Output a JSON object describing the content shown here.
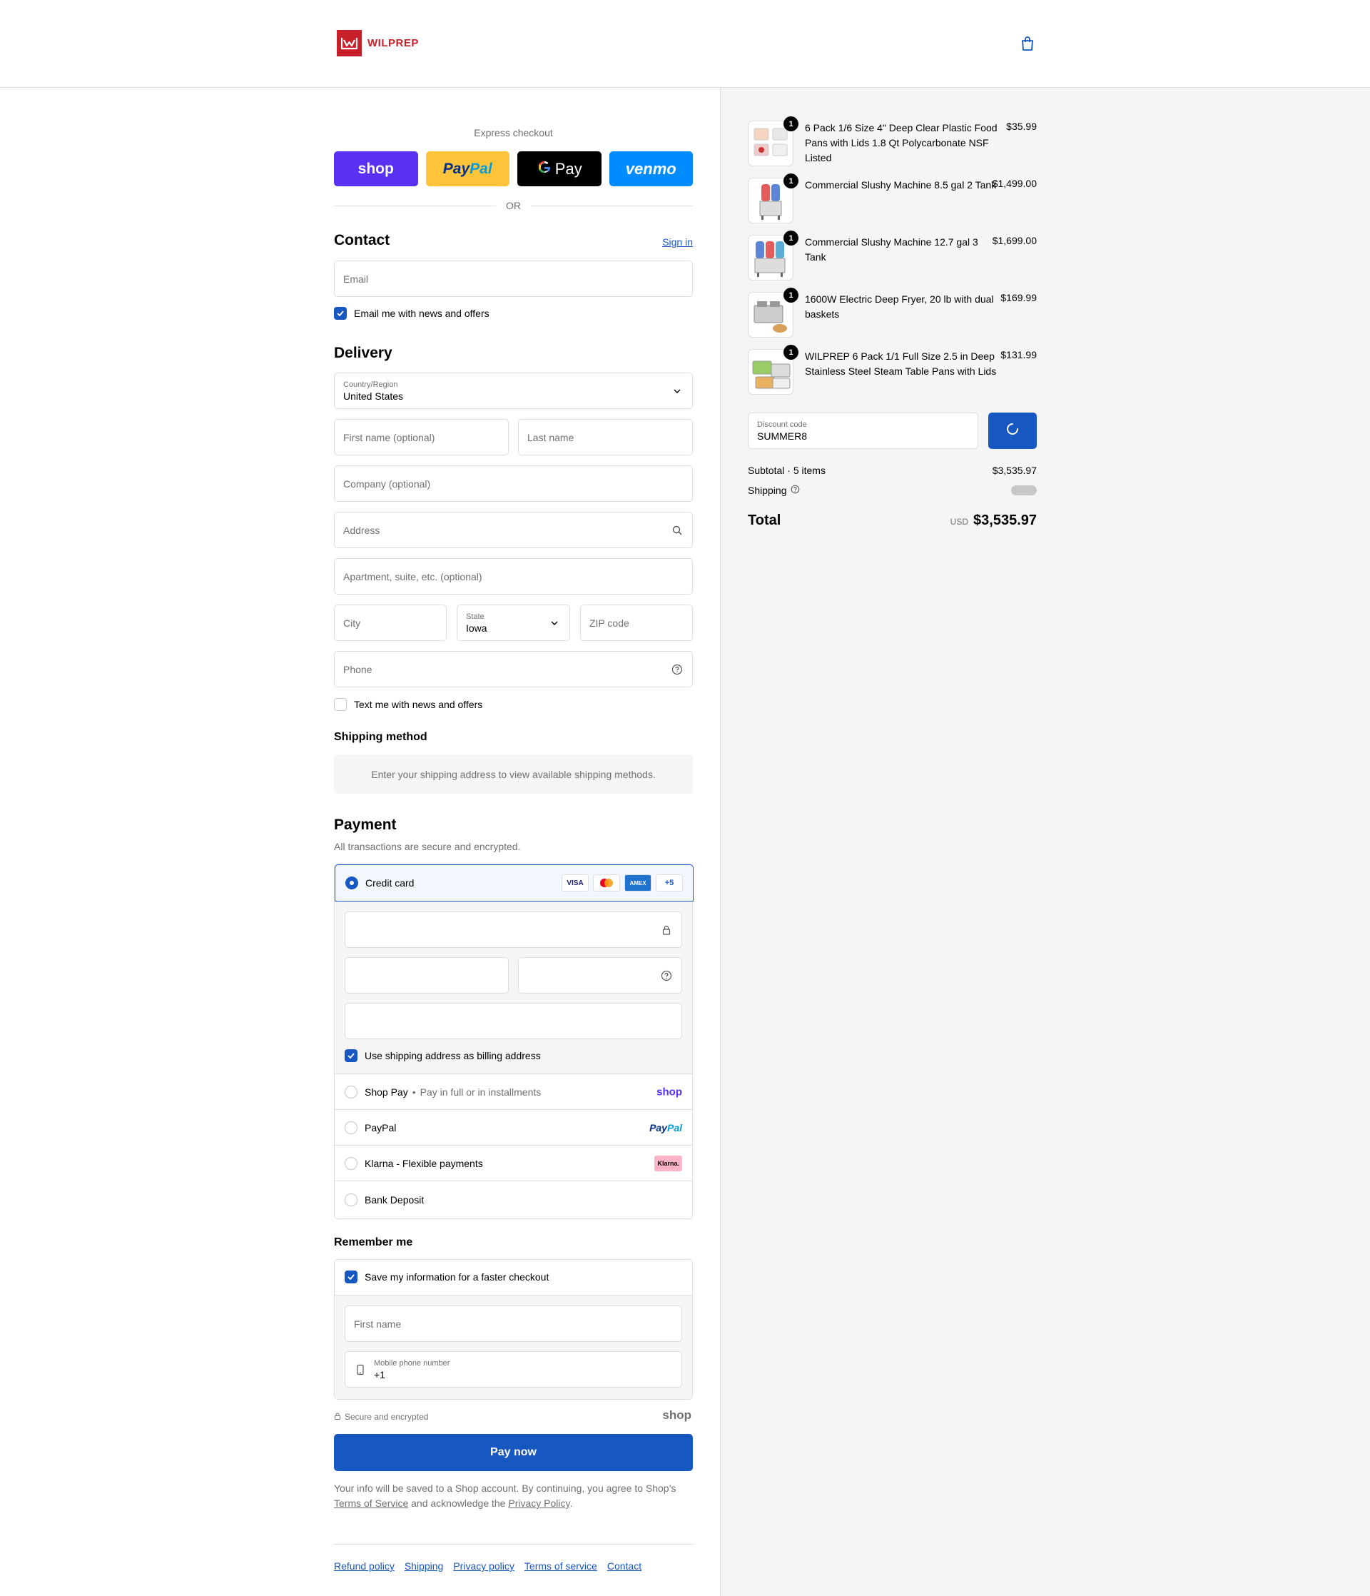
{
  "brand": {
    "name": "WILPREP"
  },
  "express": {
    "title": "Express checkout",
    "shop_label": "shop",
    "paypal_part1": "Pay",
    "paypal_part2": "Pal",
    "gpay_label": "Pay",
    "venmo_label": "venmo",
    "or_label": "OR"
  },
  "contact": {
    "heading": "Contact",
    "sign_in": "Sign in",
    "email_placeholder": "Email",
    "news_label": "Email me with news and offers"
  },
  "delivery": {
    "heading": "Delivery",
    "country_label": "Country/Region",
    "country_value": "United States",
    "first_name_placeholder": "First name (optional)",
    "last_name_placeholder": "Last name",
    "company_placeholder": "Company (optional)",
    "address_placeholder": "Address",
    "apartment_placeholder": "Apartment, suite, etc. (optional)",
    "city_placeholder": "City",
    "state_label": "State",
    "state_value": "Iowa",
    "zip_placeholder": "ZIP code",
    "phone_placeholder": "Phone",
    "text_label": "Text me with news and offers"
  },
  "shipping_method": {
    "heading": "Shipping method",
    "notice": "Enter your shipping address to view available shipping methods."
  },
  "payment": {
    "heading": "Payment",
    "subtitle": "All transactions are secure and encrypted.",
    "credit_card_label": "Credit card",
    "card_visa": "VISA",
    "card_amex": "AMEX",
    "card_more": "+5",
    "billing_label": "Use shipping address as billing address",
    "shop_pay_label": "Shop Pay",
    "shop_pay_note": "Pay in full or in installments",
    "shop_pay_logo": "shop",
    "paypal_label": "PayPal",
    "paypal_logo_part1": "Pay",
    "paypal_logo_part2": "Pal",
    "klarna_label": "Klarna - Flexible payments",
    "klarna_logo": "Klarna.",
    "bank_label": "Bank Deposit"
  },
  "remember": {
    "heading": "Remember me",
    "save_label": "Save my information for a faster checkout",
    "first_name_placeholder": "First name",
    "mobile_label": "Mobile phone number",
    "mobile_value": "+1",
    "secure_label": "Secure and encrypted",
    "shop_logo": "shop"
  },
  "pay_now": "Pay now",
  "legal": {
    "text1": "Your info will be saved to a Shop account. By continuing, you agree to Shop’s",
    "terms": "Terms of Service",
    "text2": "and acknowledge the",
    "privacy": "Privacy Policy",
    "text3": "."
  },
  "footer_links": [
    "Refund policy",
    "Shipping",
    "Privacy policy",
    "Terms of service",
    "Contact"
  ],
  "order": {
    "items": [
      {
        "qty": "1",
        "name": "6 Pack 1/6 Size 4\" Deep Clear Plastic Food Pans with Lids 1.8 Qt Polycarbonate NSF Listed",
        "price": "$35.99"
      },
      {
        "qty": "1",
        "name": "Commercial Slushy Machine 8.5 gal 2 Tank",
        "price": "$1,499.00"
      },
      {
        "qty": "1",
        "name": "Commercial Slushy Machine 12.7 gal 3 Tank",
        "price": "$1,699.00"
      },
      {
        "qty": "1",
        "name": "1600W Electric Deep Fryer, 20 lb with dual baskets",
        "price": "$169.99"
      },
      {
        "qty": "1",
        "name": "WILPREP 6 Pack 1/1 Full Size 2.5 in Deep Stainless Steel Steam Table Pans with Lids",
        "price": "$131.99"
      }
    ],
    "discount_label": "Discount code",
    "discount_value": "SUMMER8",
    "subtotal_label": "Subtotal · 5 items",
    "subtotal_value": "$3,535.97",
    "shipping_label": "Shipping",
    "total_label": "Total",
    "currency": "USD",
    "total_value": "$3,535.97"
  },
  "colors": {
    "accent": "#1757c2",
    "brand": "#c8202b",
    "shop": "#5a31f4",
    "paypal": "#ffc439",
    "venmo": "#008cff"
  }
}
